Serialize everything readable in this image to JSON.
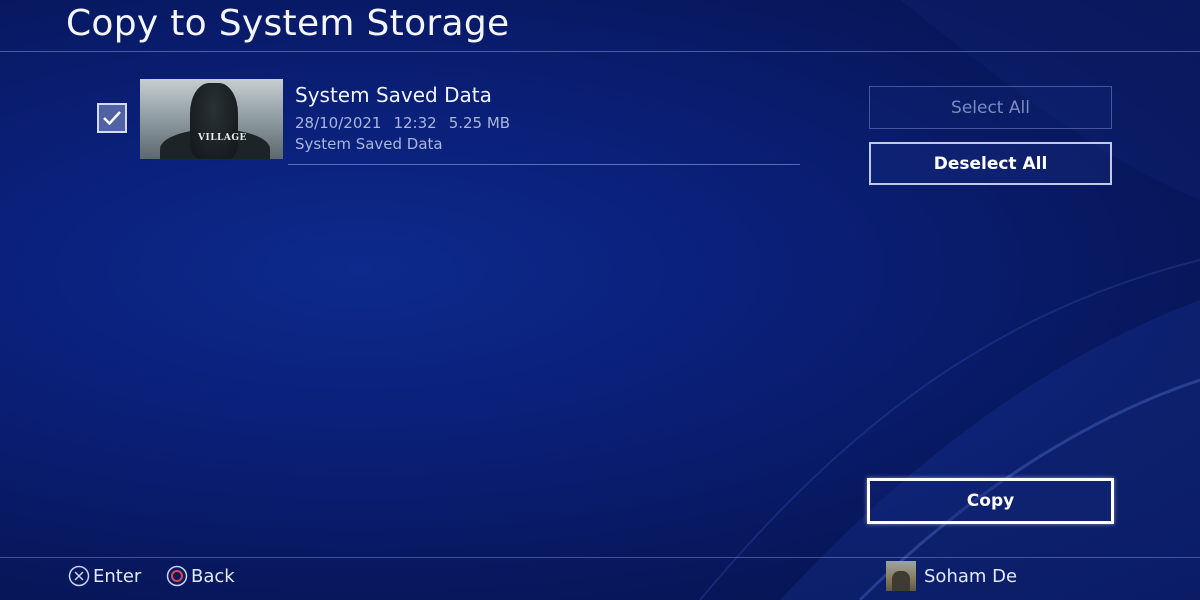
{
  "screen": {
    "title": "Copy to System Storage"
  },
  "item": {
    "title": "System Saved Data",
    "date": "28/10/2021",
    "time": "12:32",
    "size": "5.25 MB",
    "subtitle": "System Saved Data",
    "checked": true,
    "thumbnail_logo": "VILLAGE"
  },
  "actions": {
    "select_all": "Select All",
    "deselect_all": "Deselect All",
    "copy": "Copy"
  },
  "footer": {
    "enter_label": "Enter",
    "back_label": "Back",
    "user_name": "Soham De"
  },
  "colors": {
    "background": "#0a1f78",
    "text": "#ffffff",
    "muted_text": "#a9b7dc",
    "circle_button": "#e0484f"
  }
}
